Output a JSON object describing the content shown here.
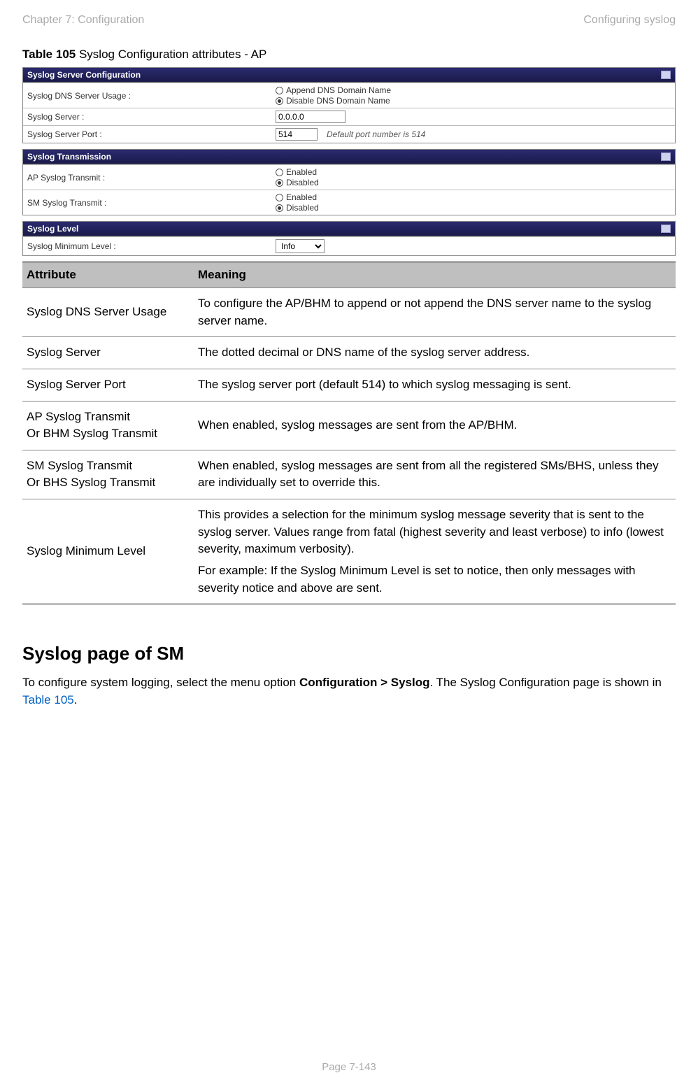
{
  "header": {
    "left": "Chapter 7:  Configuration",
    "right": "Configuring syslog"
  },
  "caption": {
    "bold": "Table 105",
    "rest": " Syslog Configuration attributes - AP"
  },
  "panel1": {
    "title": "Syslog Server Configuration",
    "row1_label": "Syslog DNS Server Usage :",
    "row1_opt1": "Append DNS Domain Name",
    "row1_opt2": "Disable DNS Domain Name",
    "row2_label": "Syslog Server :",
    "row2_value": "0.0.0.0",
    "row3_label": "Syslog Server Port :",
    "row3_value": "514",
    "row3_note": "Default port number is 514"
  },
  "panel2": {
    "title": "Syslog Transmission",
    "row1_label": "AP Syslog Transmit :",
    "row2_label": "SM Syslog Transmit :",
    "enabled": "Enabled",
    "disabled": "Disabled"
  },
  "panel3": {
    "title": "Syslog Level",
    "row1_label": "Syslog Minimum Level :",
    "row1_value": "Info"
  },
  "tbl": {
    "h1": "Attribute",
    "h2": "Meaning",
    "r1a": "Syslog DNS Server Usage",
    "r1b": "To configure the AP/BHM to append or not append the DNS server name to the syslog server name.",
    "r2a": "Syslog Server",
    "r2b": "The dotted decimal or DNS name of the syslog server address.",
    "r3a": "Syslog Server Port",
    "r3b": "The syslog server port (default 514) to which syslog messaging is sent.",
    "r4a1": "AP Syslog Transmit",
    "r4a2": "Or BHM Syslog Transmit",
    "r4b": "When enabled, syslog messages are sent from the AP/BHM.",
    "r5a1": "SM Syslog Transmit",
    "r5a2": "Or BHS Syslog Transmit",
    "r5b": "When enabled, syslog messages are sent from all the registered SMs/BHS, unless they are individually set to override this.",
    "r6a": "Syslog Minimum Level",
    "r6b1": "This provides a selection for the minimum syslog message severity that is sent to the syslog server. Values range from fatal (highest severity and least verbose) to info (lowest severity, maximum verbosity).",
    "r6b2": "For example: If the Syslog Minimum Level is set to notice, then only messages with severity notice and above are sent."
  },
  "sec_title": "Syslog page of SM",
  "sec_p_pre": "To configure system logging, select the menu option ",
  "sec_p_bold": "Configuration > Syslog",
  "sec_p_mid": ". The Syslog Configuration page is shown in ",
  "sec_p_link": "Table 105",
  "sec_p_post": ".",
  "footer": "Page 7-143"
}
